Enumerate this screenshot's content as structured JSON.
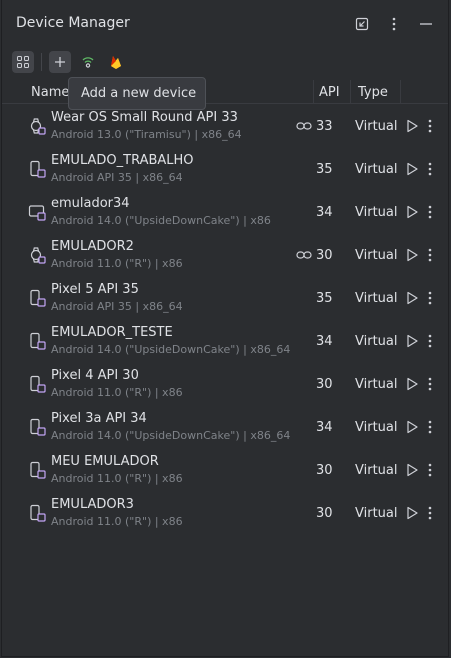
{
  "window": {
    "title": "Device Manager"
  },
  "tooltip": {
    "text": "Add a new device"
  },
  "columns": {
    "name": "Name",
    "api": "API",
    "type": "Type"
  },
  "devices": [
    {
      "name": "Wear OS Small Round API 33",
      "sub": "Android 13.0 (\"Tiramisu\") | x86_64",
      "api": "33",
      "type": "Virtual",
      "icon": "wear-os-device-icon",
      "paired": true
    },
    {
      "name": "EMULADO_TRABALHO",
      "sub": "Android API 35 | x86_64",
      "api": "35",
      "type": "Virtual",
      "icon": "phone-device-icon",
      "paired": false
    },
    {
      "name": "emulador34",
      "sub": "Android 14.0 (\"UpsideDownCake\") | x86",
      "api": "34",
      "type": "Virtual",
      "icon": "tablet-device-icon",
      "paired": false
    },
    {
      "name": "EMULADOR2",
      "sub": "Android 11.0 (\"R\") | x86",
      "api": "30",
      "type": "Virtual",
      "icon": "wear-os-device-icon",
      "paired": true
    },
    {
      "name": "Pixel 5 API 35",
      "sub": "Android API 35 | x86_64",
      "api": "35",
      "type": "Virtual",
      "icon": "phone-device-icon",
      "paired": false
    },
    {
      "name": "EMULADOR_TESTE",
      "sub": "Android 14.0 (\"UpsideDownCake\") | x86_64",
      "api": "34",
      "type": "Virtual",
      "icon": "phone-device-icon",
      "paired": false
    },
    {
      "name": "Pixel 4 API 30",
      "sub": "Android 11.0 (\"R\") | x86",
      "api": "30",
      "type": "Virtual",
      "icon": "phone-device-icon",
      "paired": false
    },
    {
      "name": "Pixel 3a API 34",
      "sub": "Android 14.0 (\"UpsideDownCake\") | x86_64",
      "api": "34",
      "type": "Virtual",
      "icon": "phone-device-icon",
      "paired": false
    },
    {
      "name": "MEU EMULADOR",
      "sub": "Android 11.0 (\"R\") | x86",
      "api": "30",
      "type": "Virtual",
      "icon": "phone-device-icon",
      "paired": false
    },
    {
      "name": "EMULADOR3",
      "sub": "Android 11.0 (\"R\") | x86",
      "api": "30",
      "type": "Virtual",
      "icon": "phone-device-icon",
      "paired": false
    }
  ],
  "colors": {
    "background": "#2b2d30",
    "accent": "#c4a6f6",
    "text": "#dfe1e5",
    "muted": "#7f8389"
  }
}
